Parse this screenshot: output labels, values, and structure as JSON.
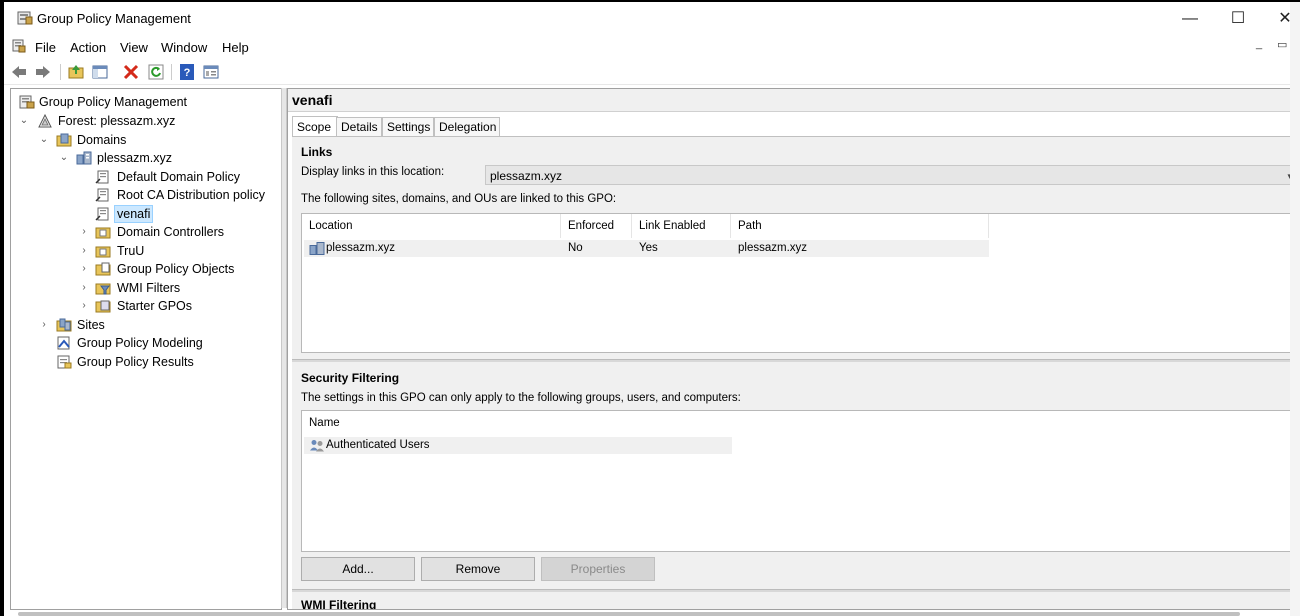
{
  "window": {
    "title": "Group Policy Management",
    "controls": {
      "minimize": "—",
      "maximize": "☐",
      "close": "✕"
    }
  },
  "menu": {
    "items": [
      "File",
      "Action",
      "View",
      "Window",
      "Help"
    ]
  },
  "toolbar": {
    "icons": [
      "back-arrow-icon",
      "forward-arrow-icon",
      "up-folder-icon",
      "show-hide-console-tree-icon",
      "delete-icon",
      "refresh-icon",
      "help-icon",
      "properties-icon"
    ]
  },
  "tree": {
    "root": "Group Policy Management",
    "forest": "Forest: plessazm.xyz",
    "domains": "Domains",
    "domain": "plessazm.xyz",
    "default_domain_policy": "Default Domain Policy",
    "root_ca_policy": "Root CA Distribution policy",
    "venafi": "venafi",
    "domain_controllers": "Domain Controllers",
    "truu": "TruU",
    "gpo_objects": "Group Policy Objects",
    "wmi_filters": "WMI Filters",
    "starter_gpos": "Starter GPOs",
    "sites": "Sites",
    "gp_modeling": "Group Policy Modeling",
    "gp_results": "Group Policy Results"
  },
  "details": {
    "gpo_name": "venafi",
    "tabs": [
      "Scope",
      "Details",
      "Settings",
      "Delegation"
    ],
    "active_tab": "Scope",
    "links": {
      "heading": "Links",
      "display_label": "Display links in this location:",
      "display_value": "plessazm.xyz",
      "linked_text": "The following sites, domains, and OUs are linked to this GPO:",
      "columns": [
        "Location",
        "Enforced",
        "Link Enabled",
        "Path"
      ],
      "rows": [
        {
          "location": "plessazm.xyz",
          "enforced": "No",
          "link_enabled": "Yes",
          "path": "plessazm.xyz"
        }
      ]
    },
    "security": {
      "heading": "Security Filtering",
      "description": "The settings in this GPO can only apply to the following groups, users, and computers:",
      "column": "Name",
      "rows": [
        "Authenticated Users"
      ],
      "buttons": {
        "add": "Add...",
        "remove": "Remove",
        "properties": "Properties"
      }
    },
    "wmi": {
      "heading": "WMI Filtering"
    }
  }
}
